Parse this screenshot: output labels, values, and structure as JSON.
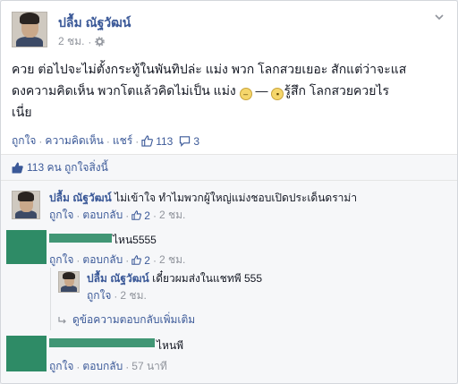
{
  "post": {
    "author": "ปลื้ม ณัฐวัฒน์",
    "time": "2 ชม.",
    "audience_icon": "gear-icon",
    "text_1": "ควย ต่อไปจะไม่ตั้งกระทู้ในพันทิปล่ะ แม่ง พวก โลกสวยเยอะ สักแต่ว่าจะแส",
    "text_2": "ดงความคิดเห็น พวกโตแล้วคิดไม่เป็น แม่ง",
    "text_2b": "—",
    "text_2c": "รู้สึก โลกสวยควยไร",
    "text_3": "เนี่ย",
    "actions": {
      "like": "ถูกใจ",
      "comment": "ความคิดเห็น",
      "share": "แชร์",
      "like_count": "113",
      "comment_count": "3",
      "separator": "·"
    }
  },
  "likes_summary": "113 คน ถูกใจสิ่งนี้",
  "comments": [
    {
      "author": "ปลื้ม ณัฐวัฒน์",
      "text": "ไม่เข้าใจ ทำไมพวกผู้ใหญ่แม่งชอบเปิดประเด็นดราม่า",
      "like": "ถูกใจ",
      "reply": "ตอบกลับ",
      "likes": "2",
      "time": "2 ชม."
    },
    {
      "author": "",
      "text": "ไหน5555",
      "like": "ถูกใจ",
      "reply": "ตอบกลับ",
      "likes": "2",
      "time": "2 ชม."
    },
    {
      "author": "",
      "text": "ไหนพี",
      "like": "ถูกใจ",
      "reply": "ตอบกลับ",
      "time": "57 นาที"
    }
  ],
  "reply": {
    "author": "ปลื้ม ณัฐวัฒน์",
    "text": "เดี๋ยวผมส่งในแชทพี 555",
    "like": "ถูกใจ",
    "time": "2 ชม."
  },
  "more_replies": "ดูข้อความตอบกลับเพิ่มเติม",
  "colors": {
    "link": "#3b5998",
    "meta": "#90949c",
    "redaction": "#2e8b66"
  }
}
